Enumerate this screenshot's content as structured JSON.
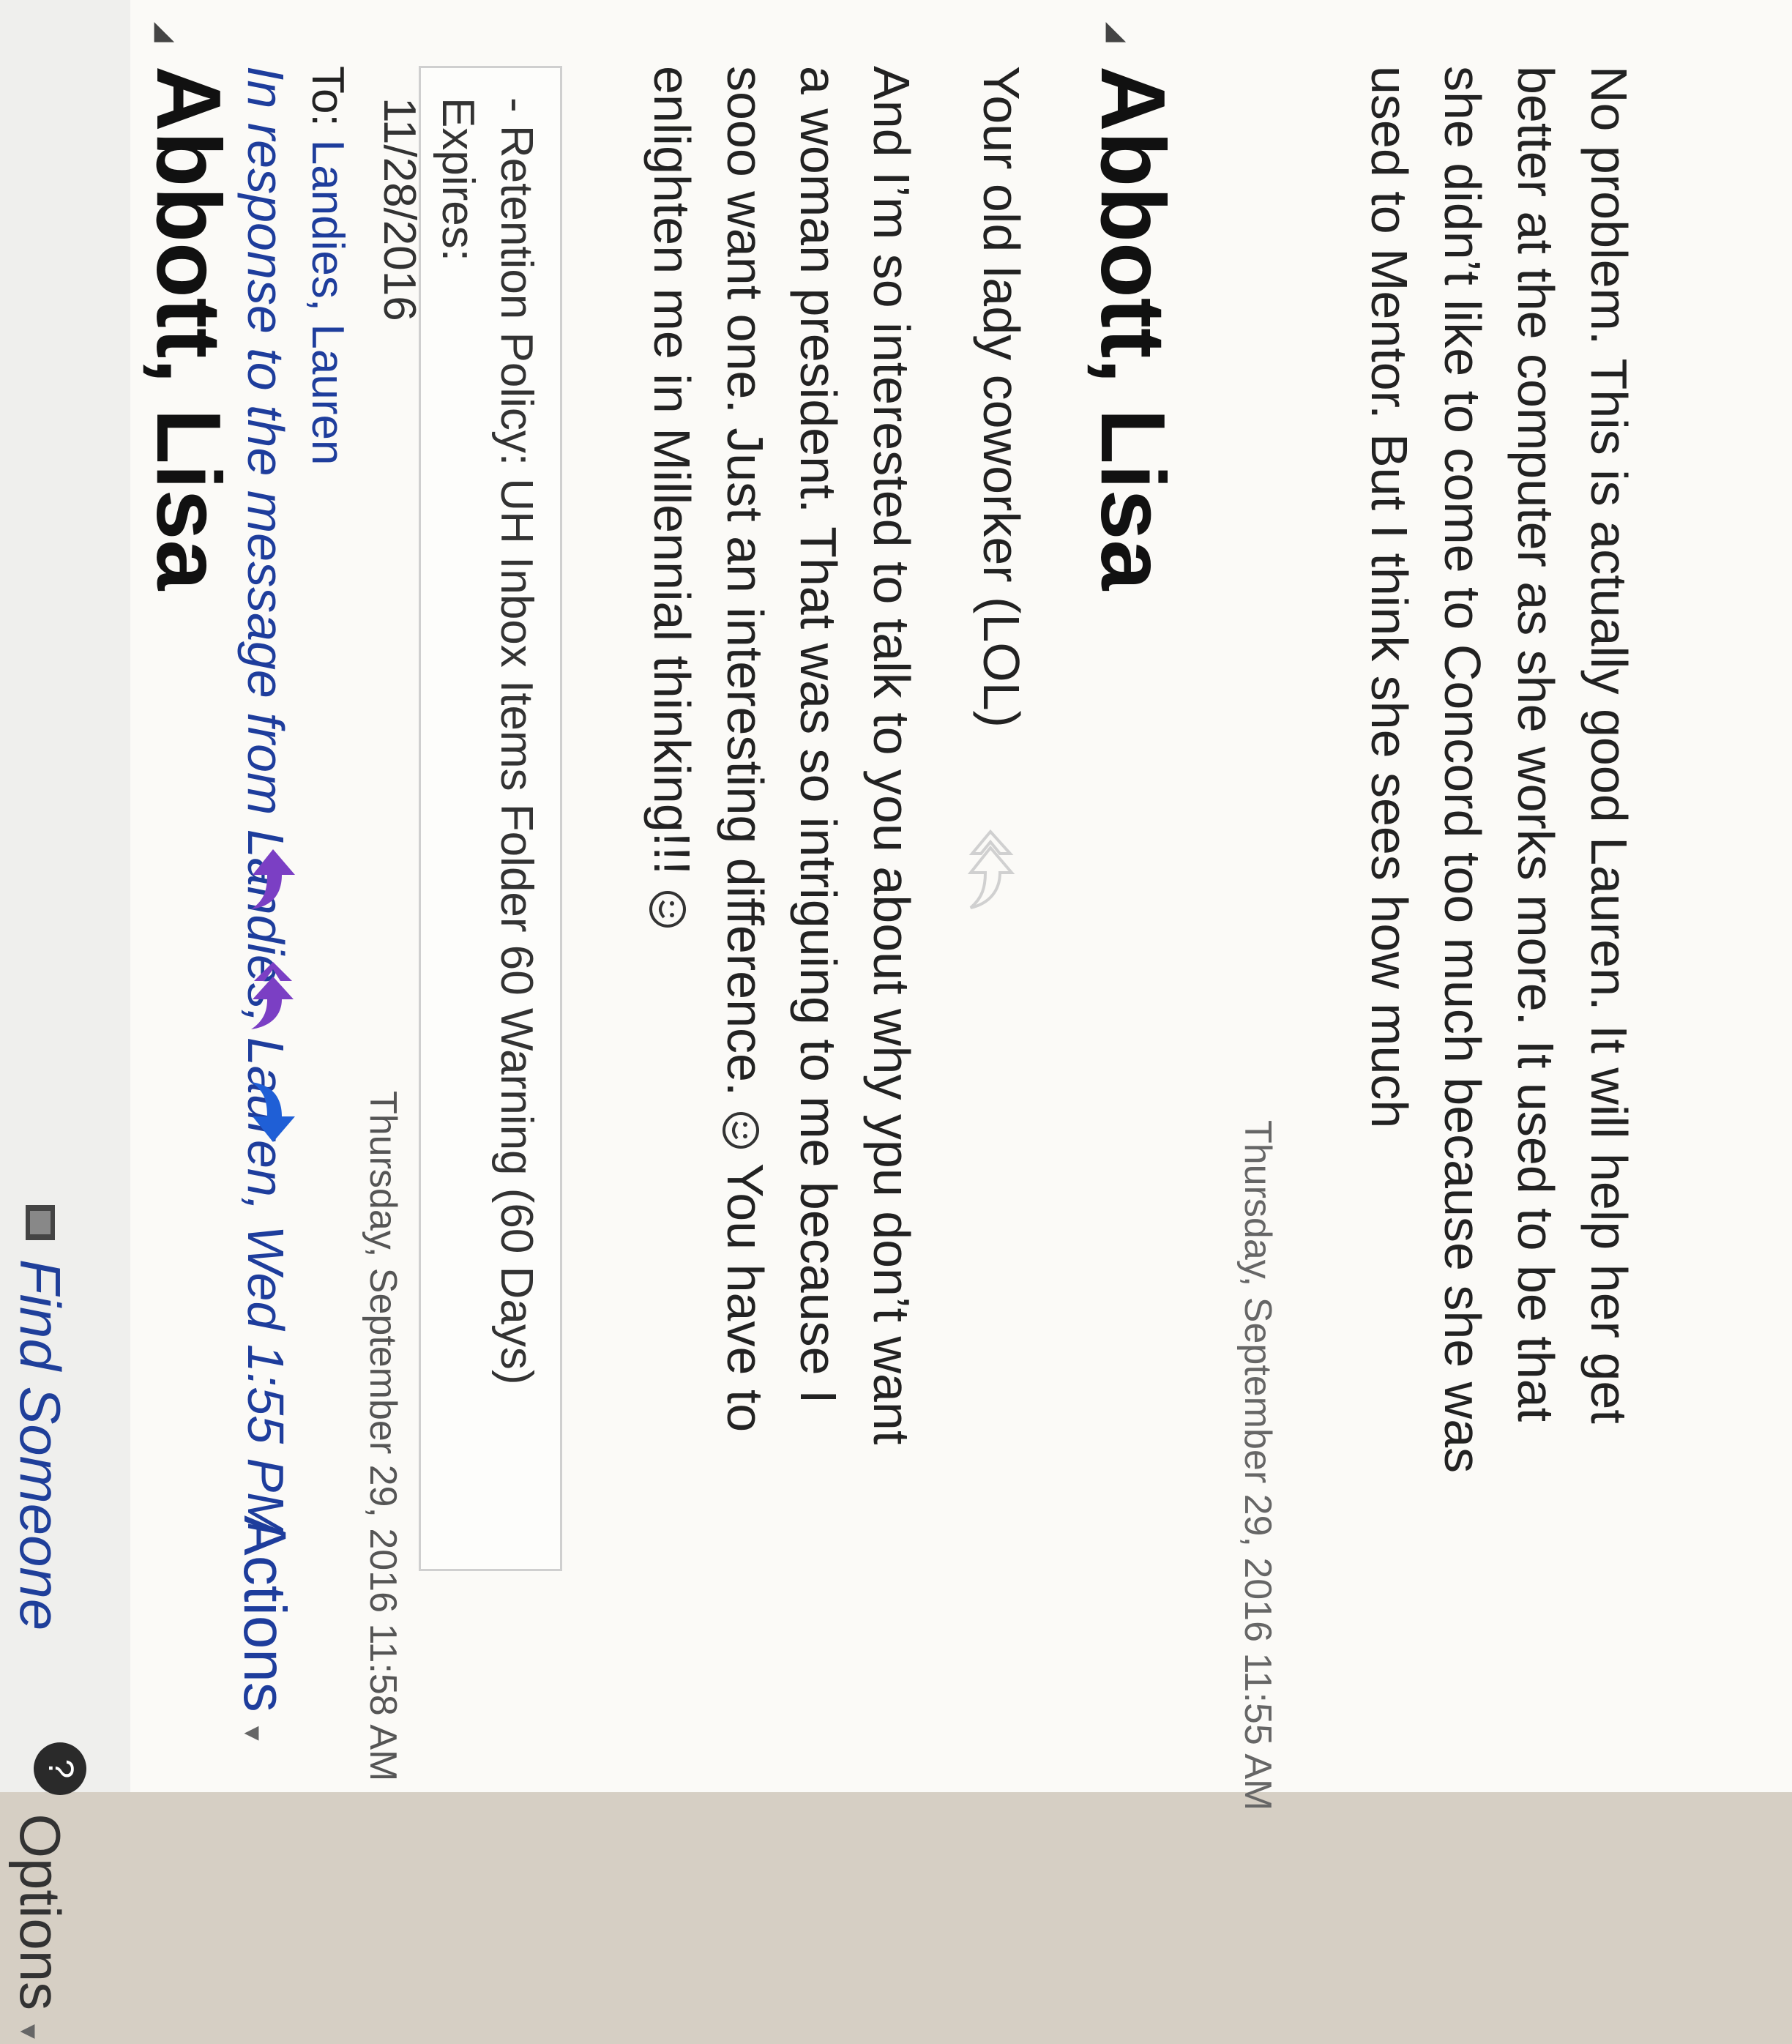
{
  "header": {
    "find_someone": "Find Someone",
    "options": "Options",
    "help": "?"
  },
  "message1": {
    "sender": "Abbott, Lisa",
    "in_response": "In response to the message from Landies, Lauren, Wed 1:55 PM",
    "to_label": "To:",
    "to_value": "Landies, Lauren",
    "actions": "Actions",
    "timestamp": "Thursday, September 29, 2016 11:58 AM",
    "retention_line1": "- Retention Policy: UH Inbox Items Folder 60 Warning (60 Days) Expires:",
    "retention_line2": "11/28/2016",
    "body_line1": "And I’m so interested to talk to you about why ypu don’t want",
    "body_line2": "a woman president.  That was so intriguing to me because I",
    "body_line3": "sooo want one.   Just an interesting difference.",
    "body_line3b": "You have to",
    "body_line4": "enlighten me in Millennial thinking!!!",
    "signoff": "Your old lady coworker  (LOL)"
  },
  "message2": {
    "sender": "Abbott, Lisa",
    "timestamp": "Thursday, September 29, 2016 11:55 AM",
    "body_line1": "No problem.  This is actually good Lauren.  It will help her get",
    "body_line2": "better at the computer as she works more.  It used to be that",
    "body_line3": "she didn’t like to come to Concord too much because she was",
    "body_line4": "used to Mentor.  But I think she sees how much"
  },
  "icons": {
    "reply": "reply-icon",
    "reply_all": "reply-all-icon",
    "forward": "forward-icon",
    "find_person": "find-person-icon",
    "smiley": "smiley-icon"
  },
  "colors": {
    "link_blue": "#1e3d9c",
    "reply_purple": "#7b3fc4",
    "forward_blue": "#1f5fd6"
  }
}
